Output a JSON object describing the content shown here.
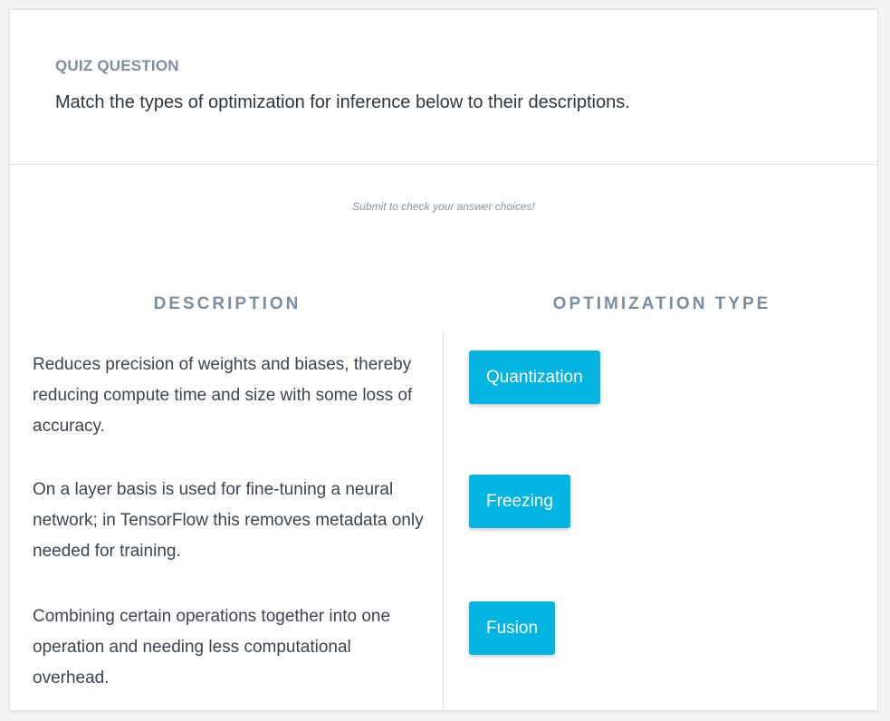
{
  "quiz": {
    "label": "QUIZ QUESTION",
    "question": "Match the types of optimization for inference below to their descriptions.",
    "hint": "Submit to check your answer choices!"
  },
  "columns": {
    "description": "DESCRIPTION",
    "optimization_type": "OPTIMIZATION TYPE"
  },
  "descriptions": [
    "Reduces precision of weights and biases, thereby reducing compute time and size with some loss of accuracy.",
    "On a layer basis is used for fine-tuning a neural network; in TensorFlow this removes metadata only needed for training.",
    "Combining certain operations together into one operation and needing less computational overhead."
  ],
  "types": [
    "Quantization",
    "Freezing",
    "Fusion"
  ],
  "colors": {
    "accent": "#04b4e1",
    "muted_heading": "#7d8da0",
    "body_text": "#3d4451"
  }
}
